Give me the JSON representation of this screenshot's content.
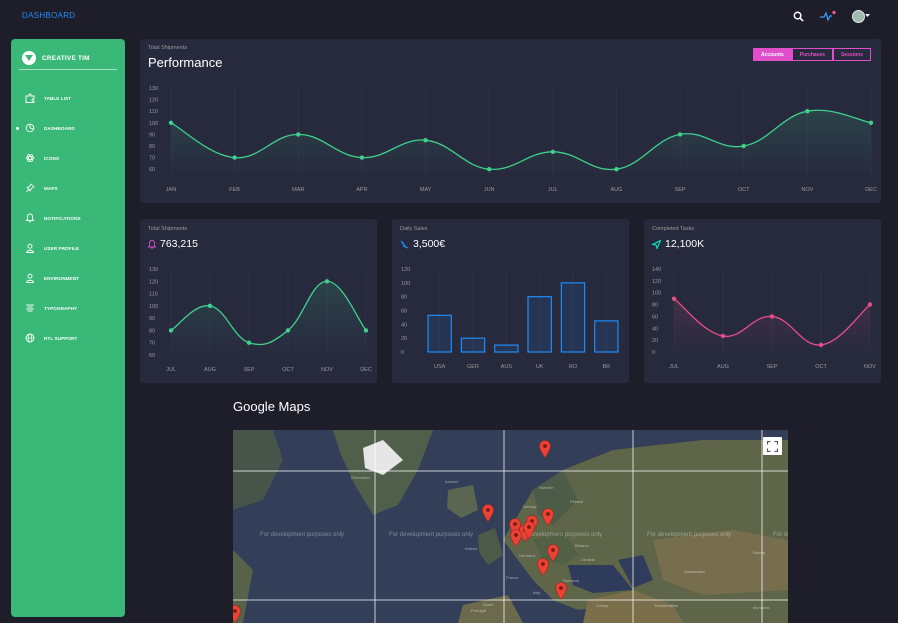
{
  "topbar": {
    "brand": "DASHBOARD"
  },
  "colors": {
    "accent": "#e14eca",
    "green": "#00f2c3",
    "blue": "#1d8cf8",
    "sidebar": "#3ab878"
  },
  "sidebar": {
    "logo_text": "CREATIVE TIM",
    "items": [
      {
        "label": "TABLE LIST",
        "icon": "puzzle-icon"
      },
      {
        "label": "DASHBOARD",
        "icon": "chart-pie-icon",
        "active": true
      },
      {
        "label": "ICONS",
        "icon": "atom-icon"
      },
      {
        "label": "MAPS",
        "icon": "pin-icon"
      },
      {
        "label": "NOTIFICATIONS",
        "icon": "bell-icon"
      },
      {
        "label": "USER PROFILE",
        "icon": "user-icon"
      },
      {
        "label": "ENVIRONMENT",
        "icon": "user-icon"
      },
      {
        "label": "TYPOGRAPHY",
        "icon": "align-center-icon"
      },
      {
        "label": "RTL SUPPORT",
        "icon": "world-icon"
      }
    ]
  },
  "performance": {
    "subtitle": "Total Shipments",
    "title": "Performance",
    "tabs": [
      "Accounts",
      "Purchases",
      "Sessions"
    ]
  },
  "shipments": {
    "subtitle": "Total Shipments",
    "value": "763,215"
  },
  "sales": {
    "subtitle": "Daily Sales",
    "value": "3,500€"
  },
  "tasks": {
    "subtitle": "Completed Tasks",
    "value": "12,100K"
  },
  "maps": {
    "title": "Google Maps",
    "dev_text": "For development purposes only",
    "places": [
      "Greenland",
      "Iceland",
      "Sweden",
      "Finland",
      "Norway",
      "Ireland",
      "Germany",
      "Belarus",
      "Ukraine",
      "France",
      "Italy",
      "Romania",
      "Spain",
      "Portugal",
      "Turkey",
      "Kazakhstan",
      "Turkmenistan",
      "Mongolia",
      "Russia"
    ]
  },
  "chart_data": [
    {
      "type": "line",
      "title": "Performance",
      "categories": [
        "JAN",
        "FEB",
        "MAR",
        "APR",
        "MAY",
        "JUN",
        "JUL",
        "AUG",
        "SEP",
        "OCT",
        "NOV",
        "DEC"
      ],
      "values": [
        100,
        70,
        90,
        70,
        85,
        60,
        75,
        60,
        90,
        80,
        110,
        100
      ],
      "yticks": [
        130,
        120,
        110,
        100,
        90,
        80,
        70,
        60
      ],
      "ylim": [
        55,
        130
      ],
      "color": "#3fd08c"
    },
    {
      "type": "line",
      "title": "763,215",
      "categories": [
        "JUL",
        "AUG",
        "SEP",
        "OCT",
        "NOV",
        "DEC"
      ],
      "values": [
        80,
        100,
        70,
        80,
        120,
        80
      ],
      "yticks": [
        130,
        120,
        110,
        100,
        90,
        80,
        70,
        60
      ],
      "ylim": [
        60,
        130
      ],
      "color": "#3fd08c"
    },
    {
      "type": "bar",
      "title": "3,500€",
      "categories": [
        "USA",
        "GER",
        "AUS",
        "UK",
        "RO",
        "BR"
      ],
      "values": [
        53,
        20,
        10,
        80,
        100,
        45
      ],
      "yticks": [
        120,
        100,
        80,
        60,
        40,
        20,
        0
      ],
      "ylim": [
        0,
        120
      ],
      "color": "#1d8cf8"
    },
    {
      "type": "line",
      "title": "12,100K",
      "categories": [
        "JUL",
        "AUG",
        "SEP",
        "OCT",
        "NOV"
      ],
      "values": [
        90,
        27,
        60,
        12,
        80
      ],
      "yticks": [
        140,
        120,
        100,
        80,
        60,
        40,
        20,
        0
      ],
      "ylim": [
        0,
        140
      ],
      "color": "#e84d8a"
    }
  ]
}
